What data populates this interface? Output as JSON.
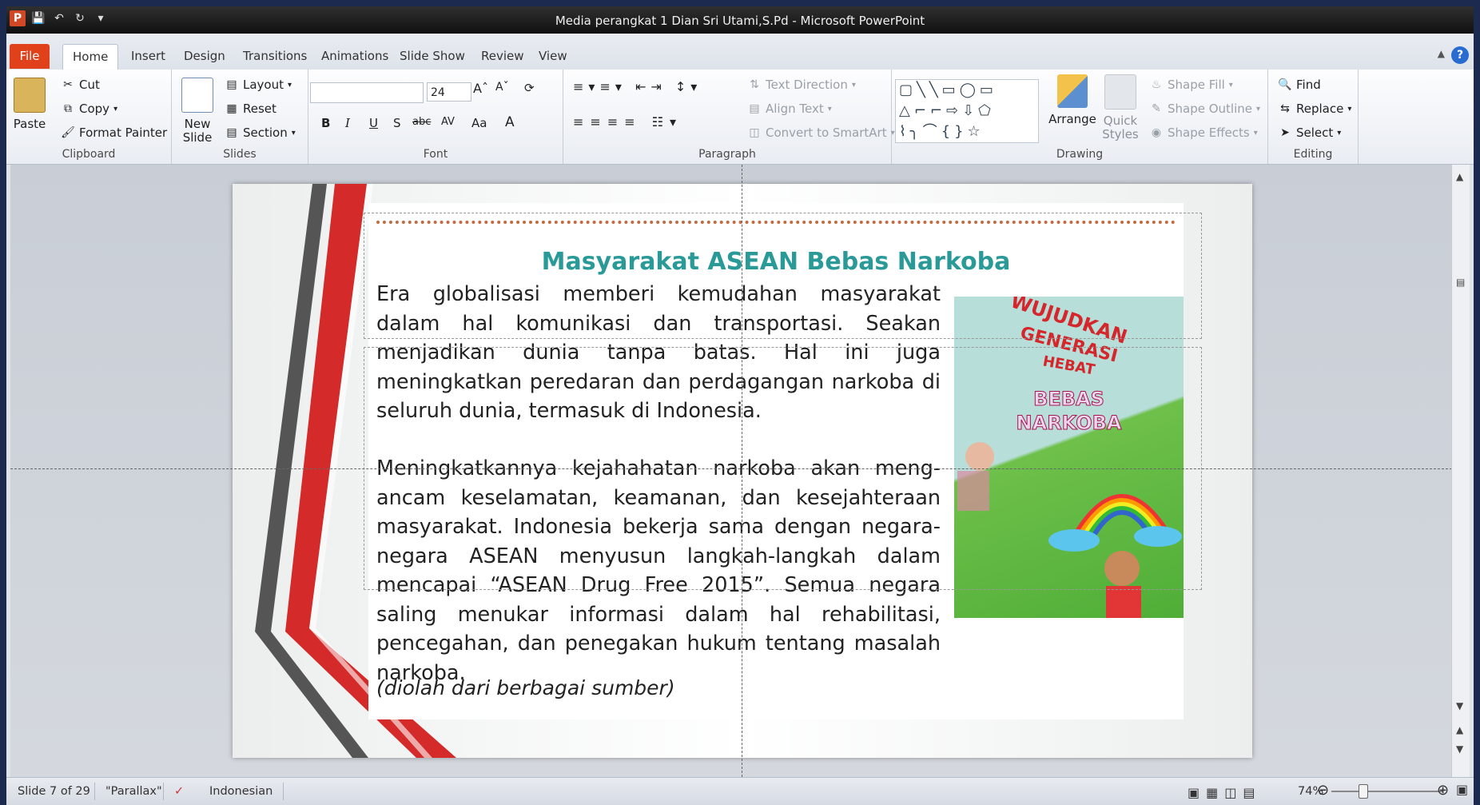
{
  "window": {
    "title": "Media perangkat 1 Dian Sri Utami,S.Pd  -  Microsoft PowerPoint",
    "app_icon": "P"
  },
  "tabs": [
    "File",
    "Home",
    "Insert",
    "Design",
    "Transitions",
    "Animations",
    "Slide Show",
    "Review",
    "View"
  ],
  "active_tab": "Home",
  "ribbon": {
    "clipboard": {
      "paste": "Paste",
      "cut": "Cut",
      "copy": "Copy",
      "format_painter": "Format Painter",
      "label": "Clipboard"
    },
    "slides": {
      "new_slide_1": "New",
      "new_slide_2": "Slide",
      "layout": "Layout",
      "reset": "Reset",
      "section": "Section",
      "label": "Slides"
    },
    "font": {
      "name": "",
      "size": "24",
      "bold": "B",
      "italic": "I",
      "underline": "U",
      "shadow": "S",
      "strike": "abc",
      "spacing": "AV",
      "case": "Aa",
      "color": "A",
      "label": "Font"
    },
    "paragraph": {
      "text_direction": "Text Direction",
      "align_text": "Align Text",
      "convert": "Convert to SmartArt",
      "label": "Paragraph"
    },
    "drawing": {
      "arrange": "Arrange",
      "quick_styles_1": "Quick",
      "quick_styles_2": "Styles",
      "shape_fill": "Shape Fill",
      "shape_outline": "Shape Outline",
      "shape_effects": "Shape Effects",
      "label": "Drawing"
    },
    "editing": {
      "find": "Find",
      "replace": "Replace",
      "select": "Select",
      "label": "Editing"
    }
  },
  "slide": {
    "title": "Masyarakat ASEAN Bebas Narkoba",
    "paragraph1": "Era globalisasi memberi kemudahan masyarakat dalam hal komunikasi dan transportasi. Seakan menjadikan dunia tanpa batas. Hal ini juga meningkatkan peredaran dan perdagangan narkoba di seluruh dunia, termasuk di Indonesia.",
    "paragraph2": "Meningkatkannya kejahahatan narkoba akan meng-ancam keselamatan, keamanan, dan kesejahteraan masyarakat. Indonesia bekerja sama dengan negara-negara ASEAN menyusun langkah-langkah dalam mencapai “ASEAN Drug Free 2015”. Semua negara saling menukar informasi dalam hal rehabilitasi, pencegahan, dan penegakan hukum tentang masalah narkoba.",
    "source": "(diolah dari berbagai sumber)",
    "poster": {
      "line1": "WUJUDKAN",
      "line2": "GENERASI",
      "line3": "HEBAT",
      "line4": "BEBAS",
      "line5": "NARKOBA"
    }
  },
  "status": {
    "slide_info": "Slide 7 of 29",
    "theme": "\"Parallax\"",
    "language": "Indonesian",
    "zoom": "74%"
  }
}
